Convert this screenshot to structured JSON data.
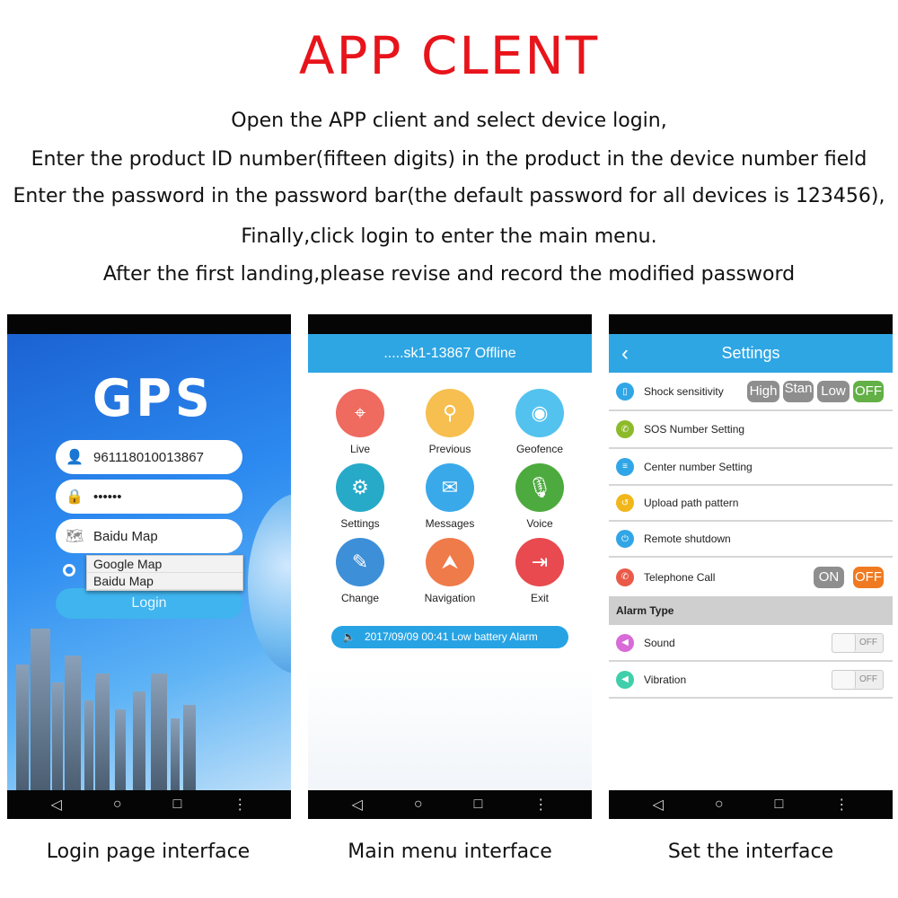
{
  "title": "APP CLENT",
  "instructions": [
    "Open the APP client and select device login,",
    "Enter the product ID number(fifteen digits) in the product in the device number field",
    "Enter the password in the password bar(the default password for all devices is 123456),",
    "Finally,click login to enter the main menu.",
    "After the first landing,please revise and record the modified password"
  ],
  "login": {
    "logo": "GPS",
    "device_id": "961118010013867",
    "password": "••••••",
    "map_selected": "Baidu Map",
    "map_options": [
      "Google Map",
      "Baidu Map"
    ],
    "login_label": "Login",
    "caption": "Login page interface"
  },
  "main": {
    "header": ".....sk1-13867 Offline",
    "items": [
      {
        "label": "Live",
        "icon": "crosshair-icon",
        "color": "#ef6a5f"
      },
      {
        "label": "Previous",
        "icon": "map-pin-icon",
        "color": "#f6bf4f"
      },
      {
        "label": "Geofence",
        "icon": "target-icon",
        "color": "#53c2ef"
      },
      {
        "label": "Settings",
        "icon": "gear-icon",
        "color": "#27aac8"
      },
      {
        "label": "Messages",
        "icon": "envelope-icon",
        "color": "#39a9ea"
      },
      {
        "label": "Voice",
        "icon": "microphone-icon",
        "color": "#4daa3e"
      },
      {
        "label": "Change",
        "icon": "edit-icon",
        "color": "#3d8fd8"
      },
      {
        "label": "Navigation",
        "icon": "navigation-icon",
        "color": "#ef7a4a"
      },
      {
        "label": "Exit",
        "icon": "exit-icon",
        "color": "#e84a4f"
      }
    ],
    "alarm": "2017/09/09 00:41 Low battery Alarm",
    "caption": "Main menu interface"
  },
  "settings": {
    "header": "Settings",
    "shock": {
      "label": "Shock sensitivity",
      "options": [
        "High",
        "Stan",
        "Low",
        "OFF"
      ],
      "selected": "OFF"
    },
    "rows": [
      "SOS Number Setting",
      "Center number Setting",
      "Upload path pattern",
      "Remote shutdown"
    ],
    "telephone": {
      "label": "Telephone Call",
      "on": "ON",
      "off": "OFF",
      "selected": "OFF"
    },
    "alarm_type": "Alarm Type",
    "sound": {
      "label": "Sound",
      "state": "OFF"
    },
    "vibration": {
      "label": "Vibration",
      "state": "OFF"
    },
    "caption": "Set the interface"
  },
  "nav": {
    "back": "◁",
    "home": "○",
    "recent": "□",
    "menu": "⋮"
  }
}
